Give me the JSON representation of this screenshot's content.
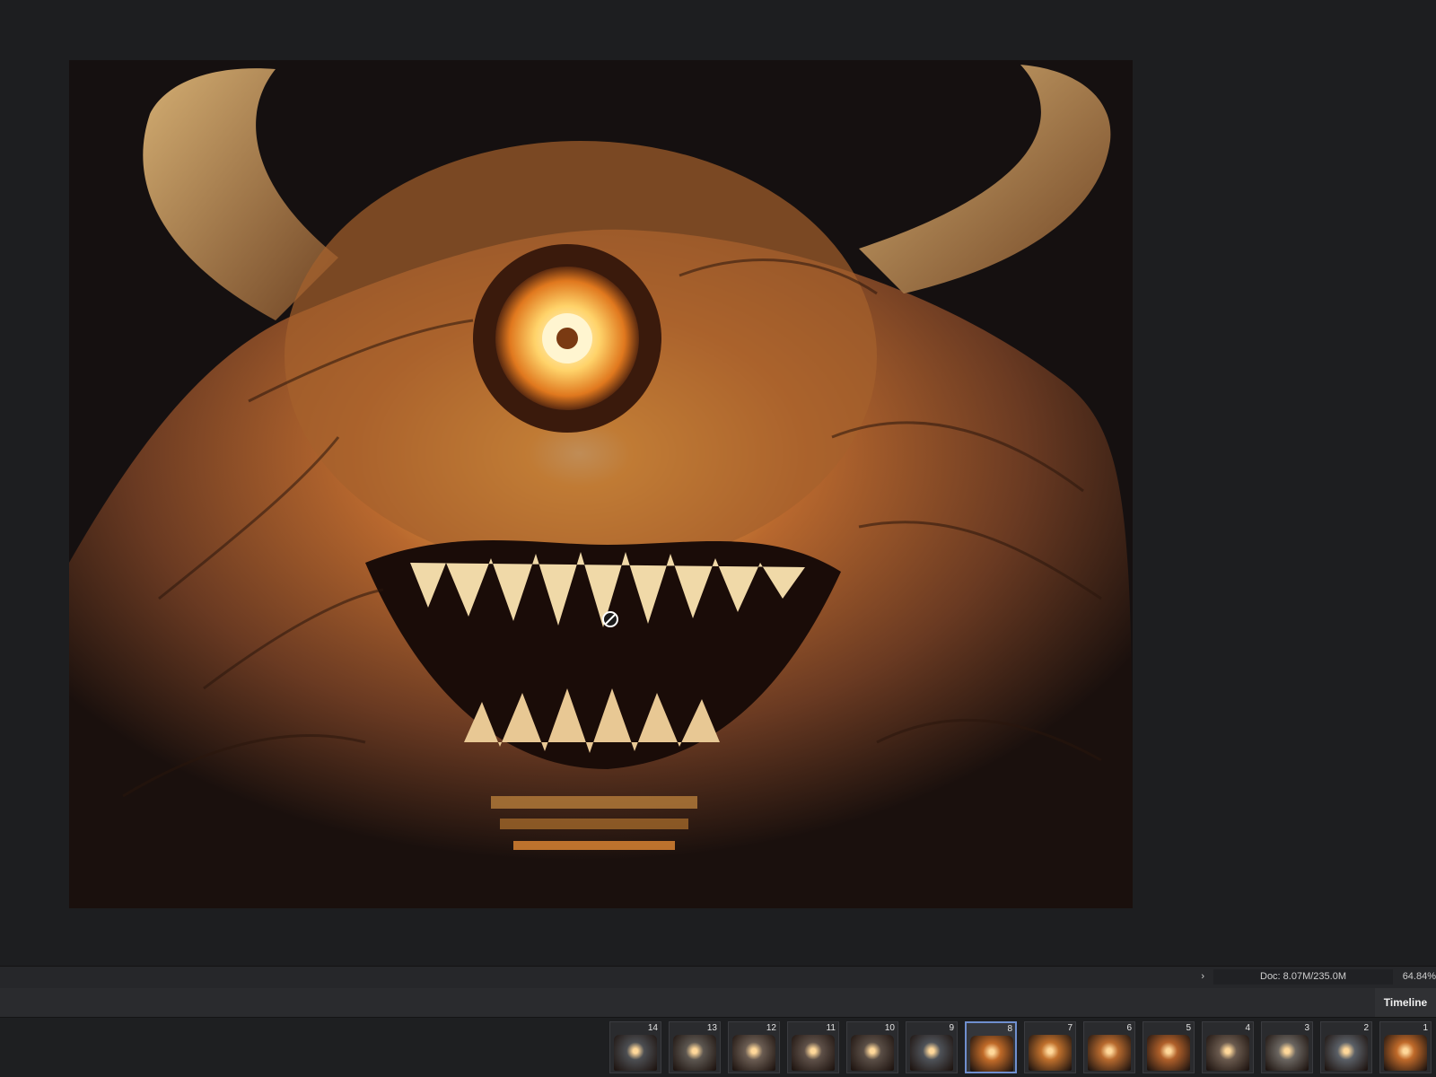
{
  "status_bar": {
    "zoom": "64.84%",
    "doc_size": "Doc: 8.07M/235.0M",
    "arrow": "›"
  },
  "panel": {
    "tab_label": "Timeline"
  },
  "frames": [
    {
      "label": "1"
    },
    {
      "label": "2"
    },
    {
      "label": "3"
    },
    {
      "label": "4"
    },
    {
      "label": "5"
    },
    {
      "label": "6"
    },
    {
      "label": "7"
    },
    {
      "label": "8"
    },
    {
      "label": "9"
    },
    {
      "label": "10"
    },
    {
      "label": "11"
    },
    {
      "label": "12"
    },
    {
      "label": "13"
    },
    {
      "label": "14"
    }
  ],
  "selected_frame": "8",
  "colors": {
    "background": "#1d1e20",
    "panel": "#2a2b2e",
    "selection": "#6f8fcf",
    "art_glow": "#ffb84a",
    "art_dark": "#120c0b"
  },
  "icons": {
    "cursor": "no-entry-cursor-icon"
  }
}
